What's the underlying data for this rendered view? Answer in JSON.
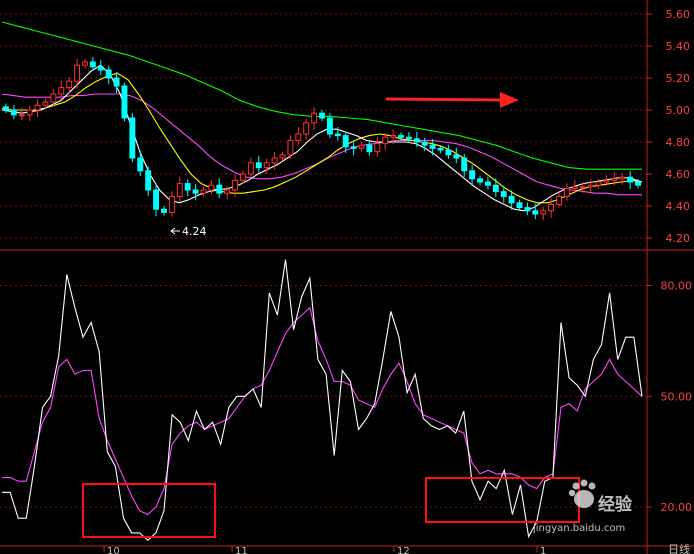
{
  "chart_data": [
    {
      "type": "candlestick",
      "panel": "price",
      "ylim": [
        4.15,
        5.65
      ],
      "y_ticks": [
        "5.60",
        "5.40",
        "5.20",
        "5.00",
        "4.80",
        "4.60",
        "4.40",
        "4.20"
      ],
      "low_annotation": "4.24",
      "colors": {
        "up": "#ff3030",
        "down": "#00ffff",
        "ma5": "#ffffff",
        "ma10": "#ffff00",
        "ma20": "#ff44ff",
        "ma60": "#00ff00"
      },
      "close": [
        5.0,
        4.97,
        4.97,
        5.0,
        5.03,
        5.05,
        5.1,
        5.14,
        5.18,
        5.28,
        5.3,
        5.27,
        5.25,
        5.2,
        5.15,
        4.95,
        4.7,
        4.62,
        4.5,
        4.38,
        4.36,
        4.46,
        4.54,
        4.5,
        4.48,
        4.5,
        4.53,
        4.48,
        4.5,
        4.56,
        4.6,
        4.67,
        4.64,
        4.67,
        4.7,
        4.72,
        4.81,
        4.85,
        4.92,
        4.98,
        4.95,
        4.85,
        4.84,
        4.77,
        4.76,
        4.78,
        4.74,
        4.79,
        4.83,
        4.84,
        4.83,
        4.82,
        4.8,
        4.78,
        4.76,
        4.75,
        4.72,
        4.7,
        4.62,
        4.57,
        4.55,
        4.53,
        4.49,
        4.46,
        4.42,
        4.39,
        4.37,
        4.35,
        4.37,
        4.41,
        4.46,
        4.51,
        4.52,
        4.52,
        4.53,
        4.55,
        4.56,
        4.57,
        4.58,
        4.55,
        4.53
      ],
      "ma5": [
        5.0,
        4.99,
        4.98,
        4.99,
        5.0,
        5.03,
        5.06,
        5.12,
        5.18,
        5.24,
        5.28,
        5.22,
        5.1,
        4.92,
        4.74,
        4.6,
        4.5,
        4.44,
        4.42,
        4.44,
        4.47,
        4.49,
        4.5,
        4.51,
        4.53,
        4.56,
        4.6,
        4.63,
        4.66,
        4.7,
        4.74,
        4.8,
        4.85,
        4.88,
        4.88,
        4.86,
        4.84,
        4.81,
        4.8,
        4.8,
        4.8,
        4.8,
        4.79,
        4.76,
        4.72,
        4.67,
        4.62,
        4.57,
        4.52,
        4.48,
        4.44,
        4.41,
        4.38,
        4.37,
        4.39,
        4.43,
        4.47,
        4.5,
        4.52,
        4.54,
        4.55,
        4.56,
        4.57,
        4.58,
        4.57,
        4.55
      ],
      "ma10": [
        5.01,
        5.0,
        5.0,
        5.0,
        5.01,
        5.03,
        5.05,
        5.09,
        5.14,
        5.18,
        5.21,
        5.23,
        5.19,
        5.1,
        5.0,
        4.89,
        4.79,
        4.69,
        4.6,
        4.54,
        4.51,
        4.49,
        4.48,
        4.48,
        4.49,
        4.5,
        4.52,
        4.55,
        4.58,
        4.62,
        4.66,
        4.7,
        4.75,
        4.79,
        4.82,
        4.84,
        4.85,
        4.84,
        4.82,
        4.81,
        4.8,
        4.79,
        4.77,
        4.74,
        4.7,
        4.66,
        4.61,
        4.56,
        4.51,
        4.47,
        4.44,
        4.42,
        4.42,
        4.44,
        4.47,
        4.5,
        4.52,
        4.53,
        4.54,
        4.55,
        4.56,
        4.55
      ],
      "ma20": [
        5.1,
        5.09,
        5.08,
        5.08,
        5.08,
        5.08,
        5.09,
        5.09,
        5.1,
        5.1,
        5.1,
        5.09,
        5.06,
        5.01,
        4.95,
        4.89,
        4.83,
        4.77,
        4.7,
        4.65,
        4.61,
        4.58,
        4.57,
        4.57,
        4.58,
        4.6,
        4.63,
        4.66,
        4.7,
        4.73,
        4.76,
        4.78,
        4.79,
        4.8,
        4.81,
        4.81,
        4.81,
        4.81,
        4.8,
        4.79,
        4.77,
        4.74,
        4.71,
        4.67,
        4.63,
        4.59,
        4.55,
        4.53,
        4.51,
        4.5,
        4.49,
        4.48,
        4.48,
        4.47,
        4.47,
        4.47
      ],
      "ma60": [
        5.55,
        5.52,
        5.49,
        5.46,
        5.43,
        5.4,
        5.37,
        5.34,
        5.3,
        5.26,
        5.22,
        5.17,
        5.12,
        5.06,
        5.02,
        4.99,
        4.97,
        4.96,
        4.96,
        4.95,
        4.94,
        4.92,
        4.9,
        4.88,
        4.86,
        4.84,
        4.81,
        4.78,
        4.74,
        4.7,
        4.67,
        4.64,
        4.63,
        4.63,
        4.63,
        4.63
      ]
    },
    {
      "type": "line",
      "panel": "indicator",
      "ylim": [
        10,
        88
      ],
      "y_ticks": [
        "80.00",
        "50.00",
        "20.00"
      ],
      "x_tick_labels": [
        "10",
        "11",
        "12",
        "1"
      ],
      "corner_label": "日线",
      "series": [
        {
          "color": "#ffffff",
          "values": [
            24,
            24,
            17,
            17,
            31,
            47,
            50,
            61,
            83,
            74,
            66,
            70,
            62,
            35,
            31,
            17,
            13,
            13,
            11,
            13,
            19,
            45,
            43,
            38,
            46,
            41,
            43,
            37,
            47,
            50,
            50,
            52,
            47,
            78,
            72,
            87,
            68,
            77,
            82,
            60,
            56,
            34,
            57,
            54,
            41,
            44,
            48,
            60,
            73,
            66,
            51,
            56,
            44,
            42,
            41,
            42,
            40,
            46,
            27,
            22,
            27,
            25,
            30,
            18,
            26,
            12,
            16,
            27,
            28,
            70,
            55,
            53,
            50,
            60,
            64,
            78,
            60,
            66,
            66,
            50
          ]
        },
        {
          "color": "#ff44ff",
          "values": [
            28,
            28,
            27,
            27,
            35,
            43,
            47,
            58,
            60,
            56,
            57,
            57,
            44,
            38,
            33,
            28,
            23,
            19,
            18,
            20,
            25,
            37,
            40,
            42,
            43,
            41,
            42,
            43,
            44,
            47,
            50,
            52,
            53,
            57,
            62,
            67,
            70,
            72,
            74,
            65,
            60,
            54,
            54,
            53,
            49,
            48,
            47,
            52,
            56,
            59,
            54,
            48,
            45,
            44,
            43,
            42,
            41,
            40,
            32,
            29,
            30,
            29,
            29,
            29,
            28,
            26,
            25,
            28,
            29,
            47,
            48,
            46,
            52,
            54,
            56,
            60,
            56,
            54,
            52,
            50
          ]
        }
      ]
    }
  ],
  "watermark": {
    "text": "经验",
    "domain": "jingyan.baidu.com"
  }
}
